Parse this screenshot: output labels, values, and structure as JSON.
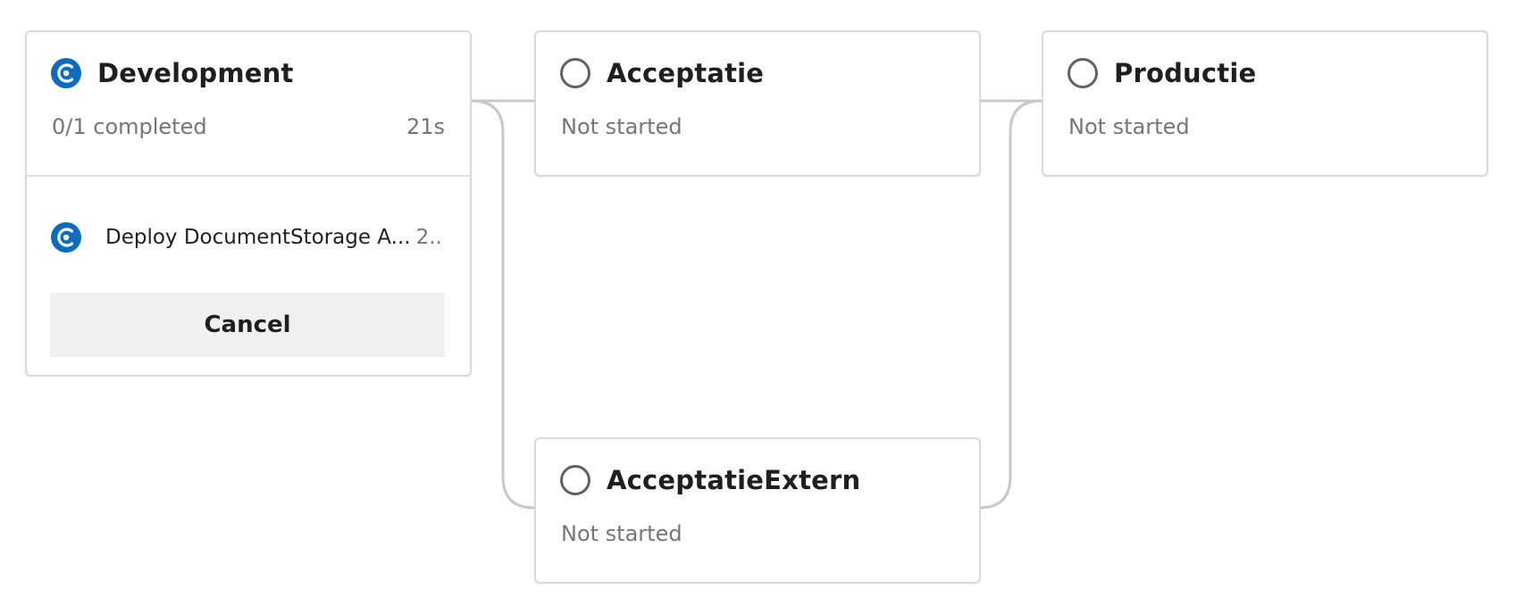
{
  "stages": {
    "development": {
      "name": "Development",
      "status_icon": "in-progress-icon",
      "progress_text": "0/1 completed",
      "duration": "21s",
      "job": {
        "name": "Deploy DocumentStorage A...",
        "time": "2..",
        "status_icon": "in-progress-icon"
      },
      "cancel_label": "Cancel"
    },
    "acceptatie": {
      "name": "Acceptatie",
      "status_icon": "not-started-icon",
      "status": "Not started"
    },
    "productie": {
      "name": "Productie",
      "status_icon": "not-started-icon",
      "status": "Not started"
    },
    "acceptatie_extern": {
      "name": "AcceptatieExtern",
      "status_icon": "not-started-icon",
      "status": "Not started"
    }
  },
  "colors": {
    "accent": "#0f6cbd",
    "border": "#d9d9d9",
    "connector": "#c8c8c8",
    "muted_text": "#767676",
    "button_bg": "#f0f0f0"
  }
}
